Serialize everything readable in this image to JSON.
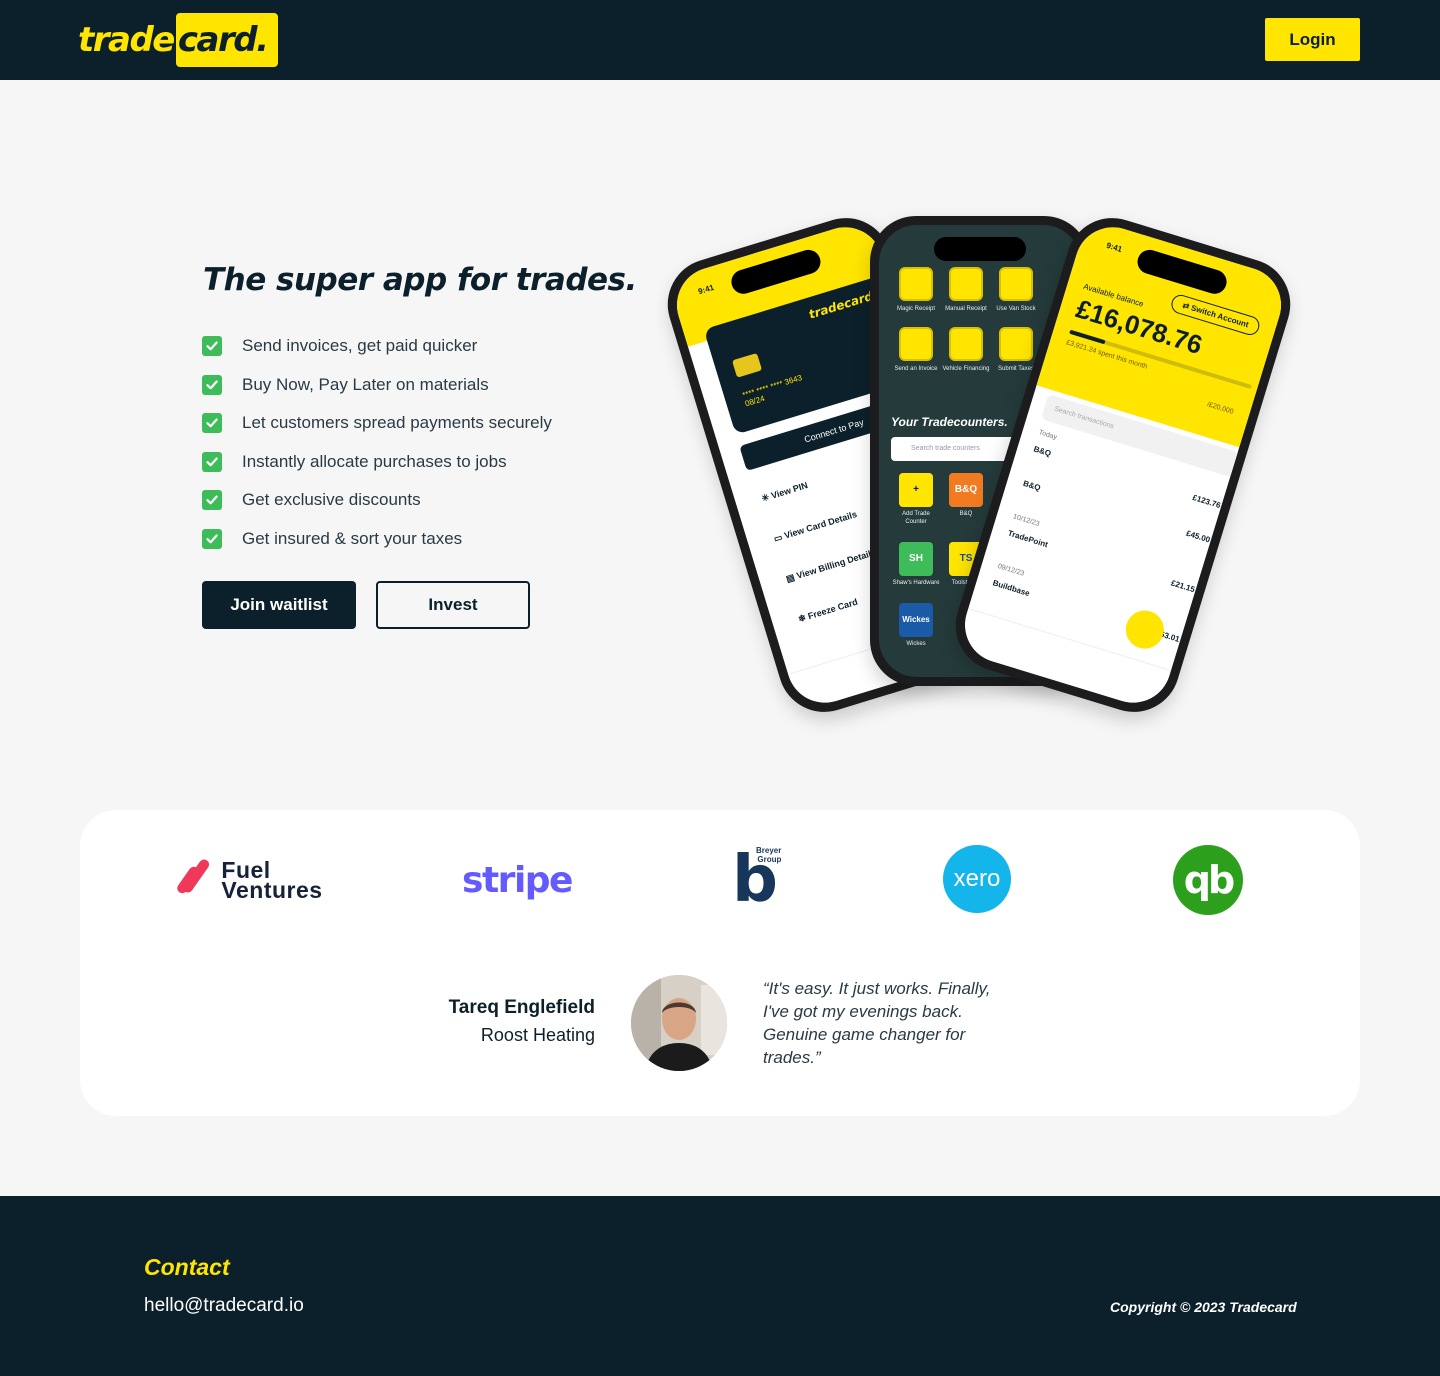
{
  "header": {
    "logo_part1": "trade",
    "logo_part2": "card.",
    "login_label": "Login"
  },
  "hero": {
    "title": "The super app for trades.",
    "features": [
      "Send invoices, get paid quicker",
      "Buy Now, Pay Later on materials",
      "Let customers spread payments securely",
      "Instantly allocate purchases to jobs",
      "Get exclusive discounts",
      "Get insured & sort your taxes"
    ],
    "join_label": "Join waitlist",
    "invest_label": "Invest"
  },
  "phone_left": {
    "status_time": "9:41",
    "card_brand": "tradecard.",
    "card_number": "**** **** **** 3643",
    "card_expiry": "08/24",
    "connect_label": "Connect to Pay",
    "menu": [
      "View PIN",
      "View Card Details",
      "View Billing Details",
      "Freeze Card"
    ]
  },
  "phone_middle": {
    "actions": [
      "Magic Receipt",
      "Manual Receipt",
      "Use Van Stock",
      "Send an Invoice",
      "Vehicle Financing",
      "Submit Taxes"
    ],
    "heading": "Your Tradecounters.",
    "search_placeholder": "Search trade counters",
    "shops": [
      {
        "label": "Add Trade Counter",
        "badge": "+",
        "color": "#ffe500",
        "text_color": "#0c202b"
      },
      {
        "label": "B&Q",
        "badge": "B&Q",
        "color": "#f27b21",
        "text_color": "#ffffff"
      },
      {
        "label": "Shaw's Hardware",
        "badge": "SH",
        "color": "#3fbc5a",
        "text_color": "#ffffff"
      },
      {
        "label": "Toolstation",
        "badge": "TS",
        "color": "#ffe500",
        "text_color": "#1d4aa0"
      },
      {
        "label": "Wickes",
        "badge": "Wickes",
        "color": "#1b5aa6",
        "text_color": "#ffffff"
      }
    ]
  },
  "phone_right": {
    "status_time": "9:41",
    "switch_label": "Switch Account",
    "available_label": "Available balance",
    "balance": "£16,078.76",
    "spent_label": "£3,921.24 spent this month",
    "limit_label": "/£20,000",
    "spent_fraction": 0.196,
    "search_placeholder": "Search transactions",
    "transactions": [
      {
        "day": "Today",
        "merchant": "B&Q",
        "amount": "£123.76"
      },
      {
        "day": "",
        "merchant": "B&Q",
        "amount": "£45.00"
      },
      {
        "day": "10/12/23",
        "merchant": "TradePoint",
        "amount": "£21.15"
      },
      {
        "day": "09/12/23",
        "merchant": "Buildbase",
        "amount": "£163.01"
      }
    ]
  },
  "partners": {
    "fuel_line1": "Fuel",
    "fuel_line2": "Ventures",
    "stripe": "stripe",
    "breyer_letter": "b",
    "breyer_group_1": "Breyer",
    "breyer_group_2": "Group",
    "xero": "xero",
    "quickbooks": "qb"
  },
  "testimonial": {
    "name": "Tareq Englefield",
    "company": "Roost Heating",
    "quote": "“It's easy. It just works. Finally, I've got my evenings back. Genuine game changer for trades.”"
  },
  "footer": {
    "contact_label": "Contact",
    "email": "hello@tradecard.io",
    "copyright": "Copyright © 2023 Tradecard"
  },
  "colors": {
    "brand_yellow": "#ffe500",
    "brand_navy": "#0c202b",
    "check_green": "#3fbc5a"
  }
}
